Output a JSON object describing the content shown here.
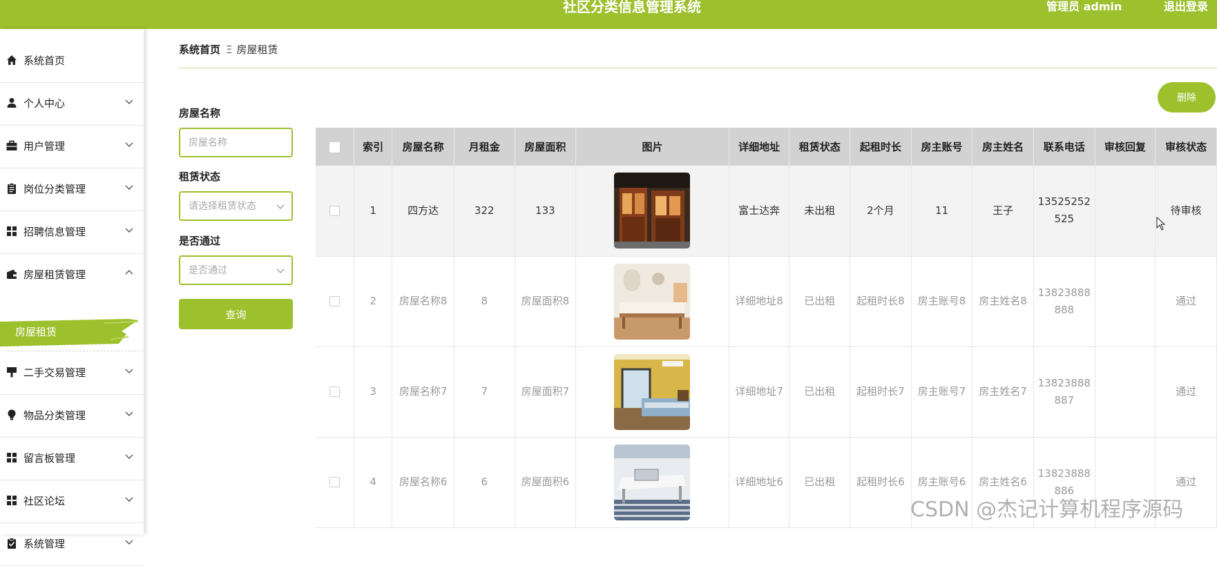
{
  "header": {
    "title": "社区分类信息管理系统",
    "admin_label": "管理员 admin",
    "logout_label": "退出登录"
  },
  "sidebar": {
    "items": [
      {
        "label": "系统首页",
        "icon": "home-icon"
      },
      {
        "label": "个人中心",
        "icon": "person-icon"
      },
      {
        "label": "用户管理",
        "icon": "briefcase-icon"
      },
      {
        "label": "岗位分类管理",
        "icon": "clipboard-icon"
      },
      {
        "label": "招聘信息管理",
        "icon": "grid-icon"
      },
      {
        "label": "房屋租赁管理",
        "icon": "wallet-icon"
      },
      {
        "label": "二手交易管理",
        "icon": "sign-icon"
      },
      {
        "label": "物品分类管理",
        "icon": "bulb-icon"
      },
      {
        "label": "留言板管理",
        "icon": "grid-icon"
      },
      {
        "label": "社区论坛",
        "icon": "grid-icon"
      },
      {
        "label": "系统管理",
        "icon": "check-clipboard-icon"
      }
    ],
    "active_sub": "房屋租赁"
  },
  "breadcrumb": {
    "home": "系统首页",
    "separator": "Ξ",
    "current": "房屋租赁"
  },
  "filters": {
    "name_label": "房屋名称",
    "name_placeholder": "房屋名称",
    "status_label": "租赁状态",
    "status_placeholder": "请选择租赁状态",
    "pass_label": "是否通过",
    "pass_placeholder": "是否通过",
    "query_label": "查询"
  },
  "actions": {
    "delete_label": "删除"
  },
  "table": {
    "columns": [
      "",
      "索引",
      "房屋名称",
      "月租金",
      "房屋面积",
      "图片",
      "详细地址",
      "租赁状态",
      "起租时长",
      "房主账号",
      "房主姓名",
      "联系电话",
      "审核回复",
      "审核状态"
    ],
    "rows": [
      {
        "index": "1",
        "name": "四方达",
        "rent": "322",
        "area": "133",
        "image": "house-storefront",
        "address": "富士达奔",
        "status": "未出租",
        "duration": "2个月",
        "account": "11",
        "owner": "王子",
        "phone": "13525252525",
        "reply": "",
        "audit": "待审核"
      },
      {
        "index": "2",
        "name": "房屋名称8",
        "rent": "8",
        "area": "房屋面积8",
        "image": "bedroom-bed",
        "address": "详细地址8",
        "status": "已出租",
        "duration": "起租时长8",
        "account": "房主账号8",
        "owner": "房主姓名8",
        "phone": "13823888888",
        "reply": "",
        "audit": "通过"
      },
      {
        "index": "3",
        "name": "房屋名称7",
        "rent": "7",
        "area": "房屋面积7",
        "image": "yellow-bedroom",
        "address": "详细地址7",
        "status": "已出租",
        "duration": "起租时长7",
        "account": "房主账号7",
        "owner": "房主姓名7",
        "phone": "13823888887",
        "reply": "",
        "audit": "通过"
      },
      {
        "index": "4",
        "name": "房屋名称6",
        "rent": "6",
        "area": "房屋面积6",
        "image": "laptop-desk",
        "address": "详细地址6",
        "status": "已出租",
        "duration": "起租时长6",
        "account": "房主账号6",
        "owner": "房主姓名6",
        "phone": "13823888886",
        "reply": "",
        "audit": "通过"
      }
    ]
  },
  "watermark": "CSDN @杰记计算机程序源码",
  "colors": {
    "accent": "#9dc02d",
    "header_bg": "#d2d2d2"
  }
}
